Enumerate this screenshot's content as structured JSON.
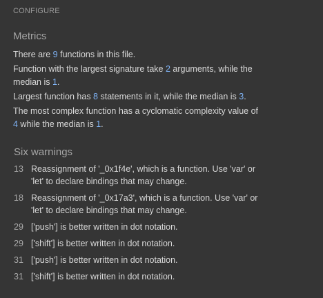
{
  "configure_label": "CONFIGURE",
  "metrics": {
    "title": "Metrics",
    "line1": {
      "pre": "There are ",
      "num": "9",
      "post": " functions in this file."
    },
    "line2": {
      "pre": "Function with the largest signature take ",
      "num1": "2",
      "mid": " arguments, while the median is ",
      "num2": "1",
      "post": "."
    },
    "line3": {
      "pre": "Largest function has ",
      "num1": "8",
      "mid": " statements in it, while the median is ",
      "num2": "3",
      "post": "."
    },
    "line4": {
      "pre": "The most complex function has a cyclomatic complexity value of ",
      "num1": "4",
      "mid": " while the median is ",
      "num2": "1",
      "post": "."
    }
  },
  "warnings": {
    "title": "Six warnings",
    "items": [
      {
        "line": "13",
        "message": "Reassignment of '_0x1f4e', which is a function. Use 'var' or 'let' to declare bindings that may change."
      },
      {
        "line": "18",
        "message": "Reassignment of '_0x17a3', which is a function. Use 'var' or 'let' to declare bindings that may change."
      },
      {
        "line": "29",
        "message": "['push'] is better written in dot notation."
      },
      {
        "line": "29",
        "message": "['shift'] is better written in dot notation."
      },
      {
        "line": "31",
        "message": "['push'] is better written in dot notation."
      },
      {
        "line": "31",
        "message": "['shift'] is better written in dot notation."
      }
    ]
  },
  "colors": {
    "background": "#353535",
    "text": "#d8d8d8",
    "accent_number": "#7fb3f5",
    "muted": "#9a9a9a"
  }
}
